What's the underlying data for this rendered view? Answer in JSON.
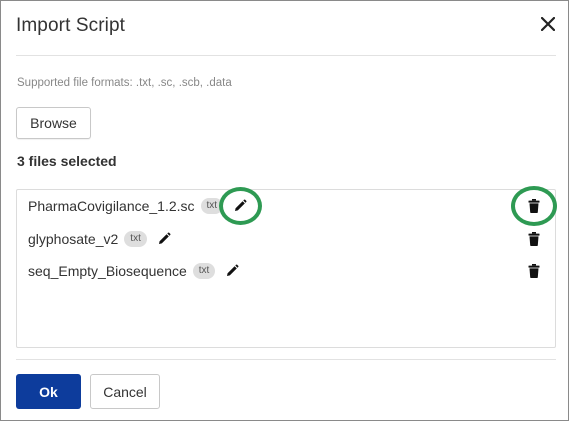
{
  "dialog": {
    "title": "Import Script",
    "close_icon": "close-icon"
  },
  "formats_text": "Supported file formats: .txt, .sc, .scb, .data",
  "browse_label": "Browse",
  "files_selected_text": "3 files selected",
  "files": [
    {
      "name": "PharmaCovigilance_1.2.sc",
      "badge": "txt"
    },
    {
      "name": "glyphosate_v2",
      "badge": "txt"
    },
    {
      "name": "seq_Empty_Biosequence",
      "badge": "txt"
    }
  ],
  "footer": {
    "ok_label": "Ok",
    "cancel_label": "Cancel"
  },
  "colors": {
    "primary": "#0d3c9c",
    "highlight": "#2e9a53",
    "badge_bg": "#dedede"
  }
}
